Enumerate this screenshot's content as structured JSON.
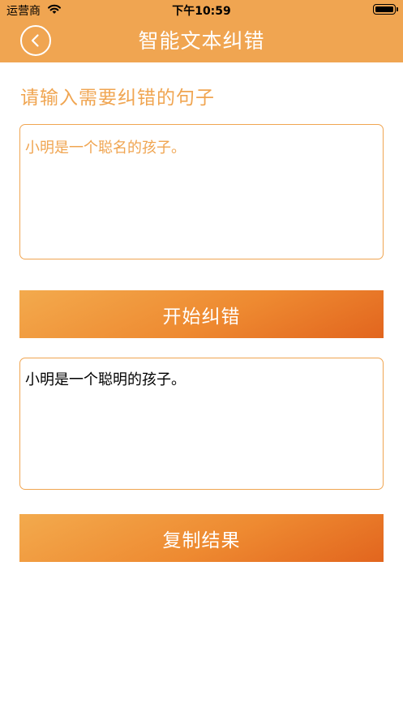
{
  "status_bar": {
    "carrier": "运营商",
    "time": "下午10:59",
    "wifi_icon": "wifi-icon",
    "battery_icon": "battery-icon"
  },
  "nav": {
    "title": "智能文本纠错",
    "back_icon": "chevron-left-icon"
  },
  "main": {
    "prompt": "请输入需要纠错的句子",
    "input_value": "小明是一个聪名的孩子。",
    "correct_button_label": "开始纠错",
    "result_value": "小明是一个聪明的孩子。",
    "copy_button_label": "复制结果"
  },
  "colors": {
    "accent": "#f0a551",
    "button_gradient_start": "#f3aa4d",
    "button_gradient_end": "#e2651e"
  }
}
